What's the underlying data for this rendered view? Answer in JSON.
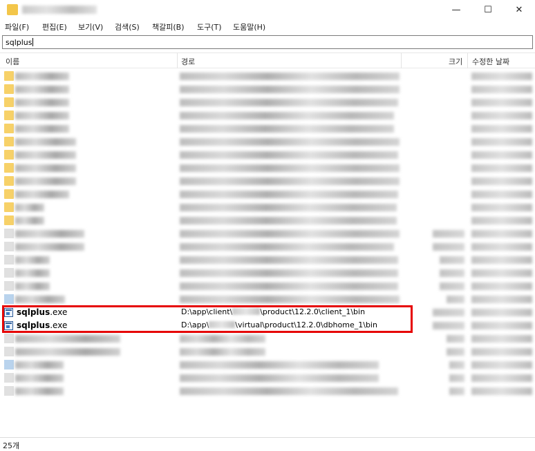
{
  "window": {
    "min_glyph": "—",
    "max_glyph": "☐",
    "close_glyph": "✕",
    "icon": "folder-app-icon"
  },
  "menu": {
    "items": [
      "파일(F)",
      "편집(E)",
      "보기(V)",
      "검색(S)",
      "책갈피(B)",
      "도구(T)",
      "도움말(H)"
    ]
  },
  "search": {
    "value": "sqlplus"
  },
  "columns": {
    "name": "이름",
    "path": "경로",
    "size": "크기",
    "modified": "수정한 날짜"
  },
  "results": [
    {
      "name_match": "sqlplus",
      "name_rest": ".exe",
      "path_before": "D:\\app\\client\\",
      "path_after": "\\product\\12.2.0\\client_1\\bin",
      "icon": "exe-icon"
    },
    {
      "name_match": "sqlplus",
      "name_rest": ".exe",
      "path_before": "D:\\app\\",
      "path_after": "\\virtual\\product\\12.2.0\\dbhome_1\\bin",
      "icon": "exe-icon"
    }
  ],
  "status": {
    "count": "25개"
  },
  "colors": {
    "highlight": "#e60000",
    "folder": "#f5c542"
  }
}
